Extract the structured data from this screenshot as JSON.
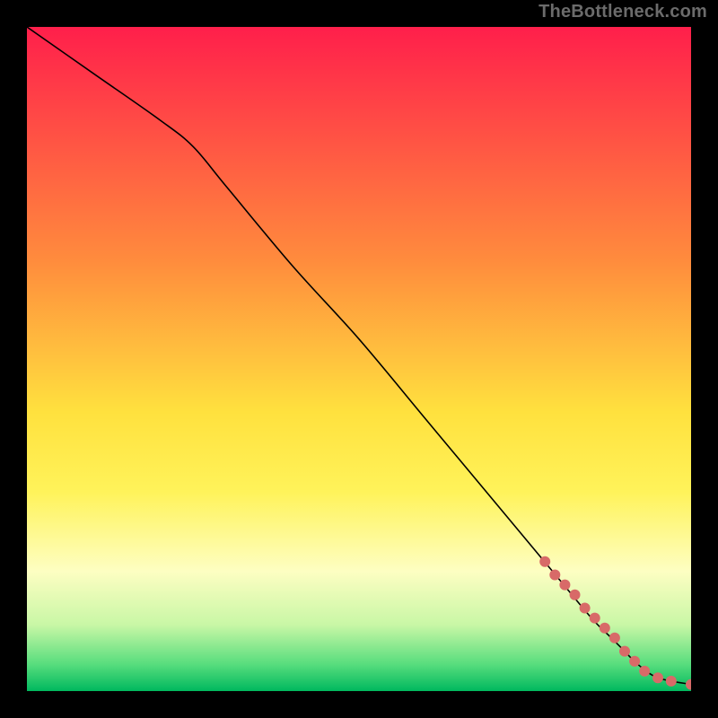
{
  "attribution": "TheBottleneck.com",
  "chart_data": {
    "type": "line",
    "title": "",
    "xlabel": "",
    "ylabel": "",
    "xlim": [
      0,
      100
    ],
    "ylim": [
      0,
      100
    ],
    "background_gradient_stops": [
      {
        "offset": 0.0,
        "color": "#ff1f4b"
      },
      {
        "offset": 0.35,
        "color": "#ff8b3d"
      },
      {
        "offset": 0.58,
        "color": "#ffe13e"
      },
      {
        "offset": 0.7,
        "color": "#fff35a"
      },
      {
        "offset": 0.82,
        "color": "#fdfec2"
      },
      {
        "offset": 0.9,
        "color": "#c9f7a6"
      },
      {
        "offset": 0.96,
        "color": "#57dd7d"
      },
      {
        "offset": 1.0,
        "color": "#00b85e"
      }
    ],
    "series": [
      {
        "name": "main-curve",
        "color": "#000000",
        "width": 1.6,
        "x": [
          0,
          10,
          20,
          25,
          30,
          40,
          50,
          60,
          70,
          80,
          85,
          88,
          90,
          92,
          95,
          100
        ],
        "y": [
          100,
          93,
          86,
          82,
          76,
          64,
          53,
          41,
          29,
          17,
          11,
          8,
          6,
          4,
          2,
          1
        ]
      }
    ],
    "points": {
      "name": "highlight-dots",
      "color": "#d86a68",
      "radius": 6,
      "x": [
        78,
        79.5,
        81,
        82.5,
        84,
        85.5,
        87,
        88.5,
        90,
        91.5,
        93,
        95,
        97,
        100
      ],
      "y": [
        19.5,
        17.5,
        16,
        14.5,
        12.5,
        11,
        9.5,
        8,
        6,
        4.5,
        3,
        2,
        1.5,
        1
      ]
    }
  }
}
